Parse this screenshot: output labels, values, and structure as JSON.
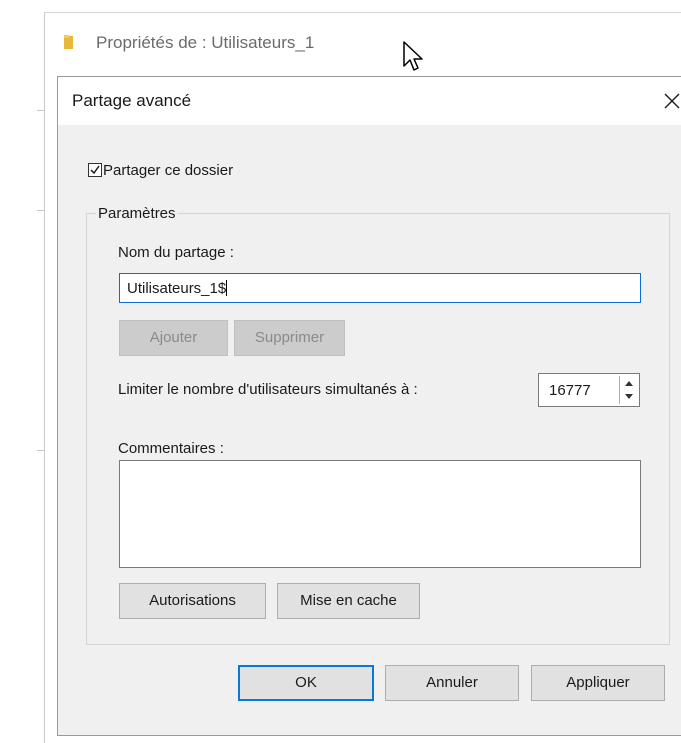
{
  "background_window": {
    "title": "Propriétés de : Utilisateurs_1",
    "folder_color": "#e8b83a"
  },
  "dialog": {
    "title": "Partage avancé",
    "close_glyph": "✕",
    "share_checkbox": {
      "label": "Partager ce dossier",
      "checked": true
    },
    "group_label": "Paramètres",
    "share_name": {
      "label": "Nom du partage :",
      "value": "Utilisateurs_1$"
    },
    "add_button": "Ajouter",
    "remove_button": "Supprimer",
    "limit": {
      "label": "Limiter le nombre d'utilisateurs simultanés à :",
      "value": "16777"
    },
    "comments": {
      "label": "Commentaires :",
      "value": ""
    },
    "permissions_button": "Autorisations",
    "caching_button": "Mise en cache",
    "ok_button": "OK",
    "cancel_button": "Annuler",
    "apply_button": "Appliquer"
  },
  "colors": {
    "focus_border": "#0a6cd6",
    "dialog_bg": "#f0f0f0",
    "button_bg": "#e1e1e1",
    "disabled_bg": "#cccccc"
  }
}
